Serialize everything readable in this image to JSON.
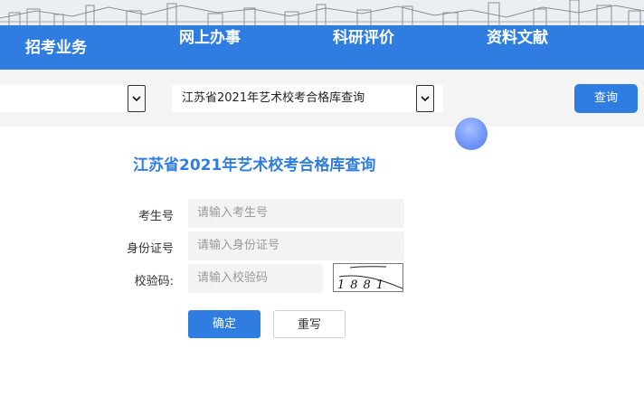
{
  "nav": {
    "items": [
      "招考业务",
      "网上办事",
      "科研评价",
      "资料文献"
    ]
  },
  "selector_bar": {
    "left_select_value": "",
    "right_select_value": "江苏省2021年艺术校考合格库查询",
    "query_label": "查询"
  },
  "form": {
    "title": "江苏省2021年艺术校考合格库查询",
    "fields": [
      {
        "label": "考生号",
        "placeholder": "请输入考生号"
      },
      {
        "label": "身份证号",
        "placeholder": "请输入身份证号"
      },
      {
        "label": "校验码:",
        "placeholder": "请输入校验码"
      }
    ],
    "captcha_text": "1881",
    "submit_label": "确定",
    "reset_label": "重写"
  },
  "colors": {
    "primary": "#2f7de1",
    "bar_bg": "#f4f4f4",
    "field_bg": "#f3f3f3"
  }
}
